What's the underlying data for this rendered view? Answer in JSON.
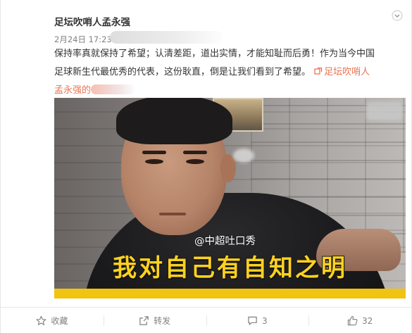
{
  "post": {
    "author": "足坛吹哨人孟永强",
    "date": "2月24日 17:23",
    "text_line1": "保持率真就保持了希望；认清差距，道出实情，才能知耻而后勇！作为当今中国",
    "text_line2": "足球新生代最优秀的代表，这份耿直，倒是让我们看到了希望。",
    "link_label_a": "足坛吹哨人",
    "link_label_b": "孟永强的",
    "link_icon": "link-icon"
  },
  "media": {
    "watermark": "@中超吐口秀",
    "caption": "我对自己有自知之明"
  },
  "actions": {
    "favorite_label": "收藏",
    "favorite_icon": "star-icon",
    "repost_label": "转发",
    "repost_icon": "share-icon",
    "comment_count": "3",
    "comment_icon": "comment-icon",
    "like_count": "32",
    "like_icon": "thumbs-up-icon"
  },
  "colors": {
    "link": "#eb7350",
    "caption": "#ffd21f",
    "muted": "#808080"
  }
}
